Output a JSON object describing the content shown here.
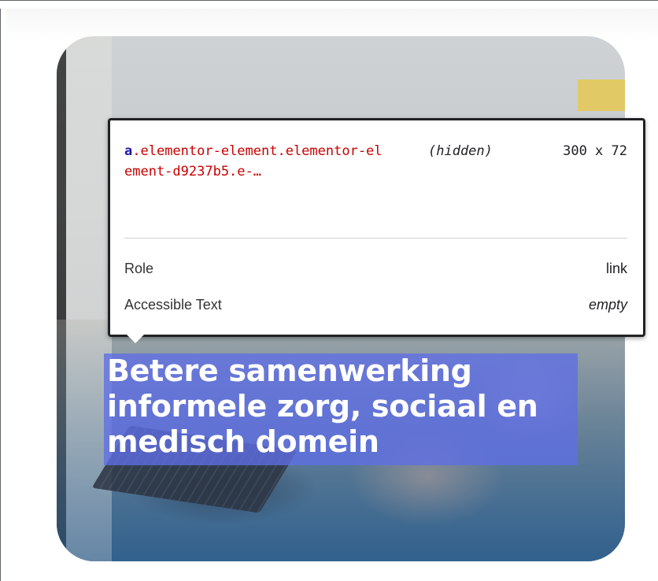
{
  "tooltip": {
    "tag": "a",
    "selector_rest": ".elementor-element.elementor-element-d9237b5.e-…",
    "hidden_label": "(hidden)",
    "dimensions": "300 x 72",
    "properties": [
      {
        "key": "Role",
        "value": "link"
      },
      {
        "key": "Accessible Text",
        "value": "empty"
      }
    ]
  },
  "card": {
    "headline": "Betere samenwerking informele zorg, sociaal en medisch domein"
  },
  "colors": {
    "highlight": "#5f6ee6",
    "selector_tag": "#1a1aa6",
    "selector_class": "#c80000"
  }
}
